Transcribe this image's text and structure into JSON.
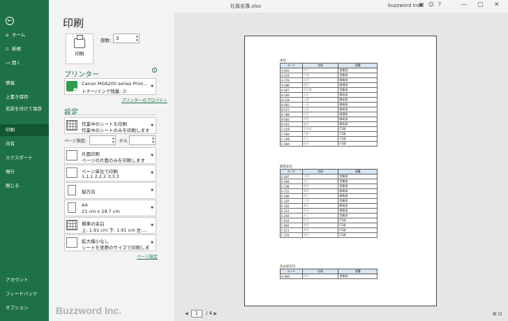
{
  "window": {
    "filename": "社員名簿.xlsx",
    "user": "buzzword Inc."
  },
  "nav": {
    "back_icon": "←",
    "items": [
      {
        "label": "ホーム",
        "icon": "⌂"
      },
      {
        "label": "新規",
        "icon": "▫"
      },
      {
        "label": "開く",
        "icon": "▭"
      },
      {
        "label": "情報"
      },
      {
        "label": "上書き保存"
      },
      {
        "label": "名前を付けて保存",
        "line2": "存"
      },
      {
        "label": "印刷"
      },
      {
        "label": "共有"
      },
      {
        "label": "エクスポート"
      },
      {
        "label": "発行"
      },
      {
        "label": "閉じる"
      },
      {
        "label": "アカウント"
      },
      {
        "label": "フィードバック"
      },
      {
        "label": "オプション"
      }
    ]
  },
  "print": {
    "title": "印刷",
    "button_label": "印刷",
    "copies_label": "部数:",
    "copies_value": "3"
  },
  "printer": {
    "heading": "プリンター",
    "name": "Canon MG6200 series Print…",
    "status": "トナー/インク残量: 少",
    "properties_link": "プリンターのプロパティ"
  },
  "settings": {
    "heading": "設定",
    "what": {
      "line1": "作業中のシートを印刷",
      "line2": "作業中のシートのみを印刷します"
    },
    "pages_label": "ページ指定:",
    "pages_to": "から",
    "sides": {
      "line1": "片面印刷",
      "line2": "ページの片面のみを印刷します"
    },
    "collate": {
      "line1": "ページ単位で印刷",
      "line2": "1,1,1    2,2,2    3,3,3"
    },
    "orientation": {
      "line1": "縦方向"
    },
    "paper": {
      "line1": "A4",
      "line2": "21 cm x 29.7 cm"
    },
    "margins": {
      "line1": "標準の余白",
      "line2": "上: 1.91 cm 下: 1.91 cm 左:…"
    },
    "scaling": {
      "line1": "拡大縮小なし",
      "line2": "シートを実際のサイズで印刷します"
    },
    "page_setup_link": "ページ設定"
  },
  "preview": {
    "current_page": "1",
    "total_pages": "/ 4",
    "sections": [
      {
        "title": "本社",
        "headers": [
          "コード",
          "名前",
          "部署"
        ],
        "rows": [
          [
            "A-091",
            "鈴木",
            "営業部"
          ],
          [
            "A-254",
            "中澤",
            "営業部"
          ],
          [
            "A-178",
            "吉田",
            "総務部"
          ],
          [
            "A-088",
            "岡田",
            "経理部"
          ],
          [
            "A-067",
            "高谷雅",
            "営業部"
          ],
          [
            "B-189",
            "吉井",
            "開発部"
          ],
          [
            "B-128",
            "小野",
            "開発部"
          ],
          [
            "B-083",
            "一田",
            "総務部"
          ],
          [
            "B-077",
            "山田",
            "開発部"
          ],
          [
            "B-188",
            "石田",
            "経理部"
          ],
          [
            "B-081",
            "伊田",
            "開発部"
          ],
          [
            "B-201",
            "倉本",
            "開発部"
          ],
          [
            "C-018",
            "宮本家",
            "CS部"
          ],
          [
            "C-084",
            "古野",
            "CS部"
          ],
          [
            "C-198",
            "中上",
            "CS部"
          ],
          [
            "C-084",
            "秋田",
            "CS部"
          ]
        ]
      },
      {
        "title": "関西支社",
        "headers": [
          "コード",
          "名前",
          "部署"
        ],
        "rows": [
          [
            "E-087",
            "大野",
            "営業部"
          ],
          [
            "E-068",
            "北川",
            "営業部"
          ],
          [
            "E-148",
            "福田",
            "営業部"
          ],
          [
            "E-151",
            "東野",
            "総務部"
          ],
          [
            "E-089",
            "西川",
            "総務部"
          ],
          [
            "E-187",
            "三田",
            "営業部"
          ],
          [
            "E-102",
            "野村",
            "開発部"
          ],
          [
            "E-115",
            "平田",
            "総務部"
          ],
          [
            "E-204",
            "井上",
            "営業部"
          ],
          [
            "F-034",
            "町沢",
            "CS部"
          ],
          [
            "F-089",
            "福井",
            "CS部"
          ],
          [
            "F-211",
            "原田",
            "CS部"
          ],
          [
            "F-176",
            "地井",
            "CS部"
          ]
        ]
      },
      {
        "title": "名古屋支社",
        "headers": [
          "コード",
          "名前",
          "部署"
        ],
        "rows": [
          [
            "H-080",
            "桜田",
            "営業部"
          ]
        ]
      }
    ]
  },
  "watermark": "Buzzword Inc."
}
